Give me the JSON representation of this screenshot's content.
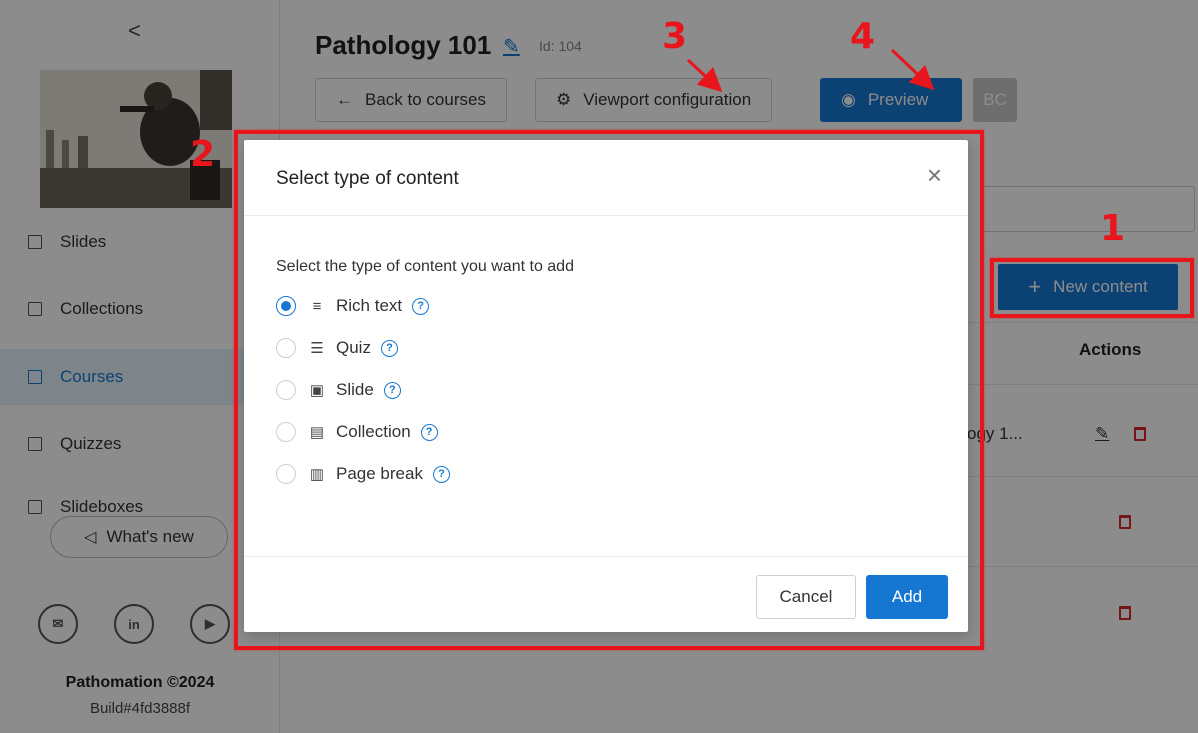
{
  "sidebar": {
    "collapse_glyph": "<",
    "nav": [
      {
        "label": "Slides",
        "icon": "image-icon"
      },
      {
        "label": "Collections",
        "icon": "collection-icon"
      },
      {
        "label": "Courses",
        "icon": "book-icon",
        "active": true
      },
      {
        "label": "Quizzes",
        "icon": "list-icon"
      },
      {
        "label": "Slideboxes",
        "icon": "box-icon"
      }
    ],
    "whats_new": "What's new",
    "social": [
      "mail-icon",
      "linkedin-icon",
      "youtube-icon"
    ],
    "social_glyphs": [
      "✉",
      "in",
      "▶"
    ],
    "copyright": "Pathomation ©2024",
    "build": "Build#4fd3888f"
  },
  "header": {
    "title": "Pathology 101",
    "id_label": "Id: 104",
    "back_button": "Back to courses",
    "viewport_button": "Viewport configuration",
    "preview_button": "Preview",
    "bc_label": "BC"
  },
  "content": {
    "new_content_button": "New content",
    "actions_header": "Actions",
    "row_text": "ogy 1..."
  },
  "modal": {
    "title": "Select type of content",
    "close_glyph": "×",
    "description": "Select the type of content you want to add",
    "options": [
      {
        "label": "Rich text",
        "icon": "rich-text-icon",
        "glyph": "≡",
        "selected": true
      },
      {
        "label": "Quiz",
        "icon": "quiz-icon",
        "glyph": "☰",
        "selected": false
      },
      {
        "label": "Slide",
        "icon": "slide-icon",
        "glyph": "▣",
        "selected": false
      },
      {
        "label": "Collection",
        "icon": "collection-icon",
        "glyph": "▤",
        "selected": false
      },
      {
        "label": "Page break",
        "icon": "page-break-icon",
        "glyph": "▥",
        "selected": false
      }
    ],
    "help_glyph": "?",
    "cancel": "Cancel",
    "add": "Add"
  },
  "annotations": {
    "labels": [
      "1",
      "2",
      "3",
      "4"
    ],
    "color": "#e8151d"
  },
  "colors": {
    "primary": "#1677d2",
    "danger": "#d9262c"
  }
}
